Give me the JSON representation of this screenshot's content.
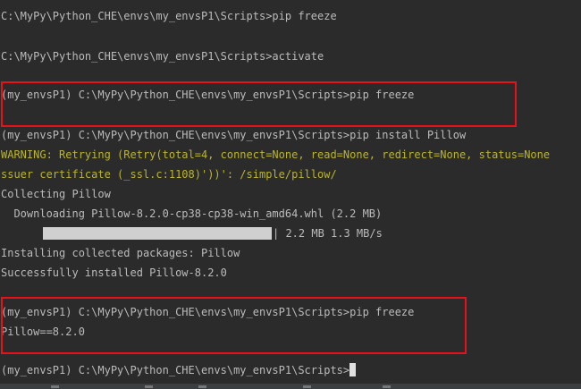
{
  "terminal": {
    "lines": [
      "C:\\MyPy\\Python_CHE\\envs\\my_envsP1\\Scripts>pip freeze",
      "C:\\MyPy\\Python_CHE\\envs\\my_envsP1\\Scripts>activate",
      "(my_envsP1) C:\\MyPy\\Python_CHE\\envs\\my_envsP1\\Scripts>pip freeze",
      "(my_envsP1) C:\\MyPy\\Python_CHE\\envs\\my_envsP1\\Scripts>pip install Pillow",
      "WARNING: Retrying (Retry(total=4, connect=None, read=None, redirect=None, status=None",
      "ssuer certificate (_ssl.c:1108)'))': /simple/pillow/",
      "Collecting Pillow",
      "  Downloading Pillow-8.2.0-cp38-cp38-win_amd64.whl (2.2 MB)",
      "| 2.2 MB 1.3 MB/s",
      "Installing collected packages: Pillow",
      "Successfully installed Pillow-8.2.0",
      "(my_envsP1) C:\\MyPy\\Python_CHE\\envs\\my_envsP1\\Scripts>pip freeze",
      "Pillow==8.2.0",
      "(my_envsP1) C:\\MyPy\\Python_CHE\\envs\\my_envsP1\\Scripts>"
    ],
    "download_progress": 1.0
  },
  "colors": {
    "background": "#2b2b2b",
    "text": "#bbbbbb",
    "warning": "#bbb529",
    "highlight_box": "#e8111a"
  }
}
